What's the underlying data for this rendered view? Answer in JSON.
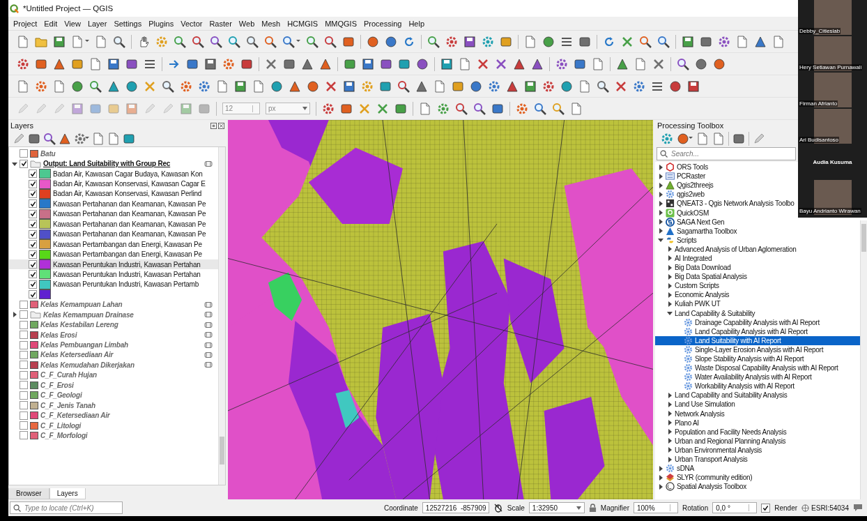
{
  "window": {
    "title": "*Untitled Project — QGIS"
  },
  "menu": [
    "Project",
    "Edit",
    "View",
    "Layer",
    "Settings",
    "Plugins",
    "Vector",
    "Raster",
    "Web",
    "Mesh",
    "HCMGIS",
    "MMQGIS",
    "Processing",
    "Help"
  ],
  "digitizing_toolbar": {
    "size_value": "12",
    "unit": "px"
  },
  "layers_panel": {
    "title": "Layers",
    "items": [
      {
        "kind": "layer",
        "name": "Batu",
        "checked": false,
        "indicator": false,
        "color": "#e0643c"
      },
      {
        "kind": "group",
        "name": "Output: Land Suitability with Group Rec",
        "checked": true,
        "indicator": true,
        "expanded": true,
        "children": [
          {
            "name": "Badan Air, Kawasan Cagar Budaya, Kawasan Kon",
            "checked": true,
            "selected": false,
            "color": "#4cc890"
          },
          {
            "name": "Badan Air, Kawasan Konservasi, Kawasan Cagar E",
            "checked": true,
            "selected": false,
            "color": "#e858c8"
          },
          {
            "name": "Badan Air, Kawasan Konservasi, Kawasan Perlind",
            "checked": true,
            "selected": false,
            "color": "#e04020"
          },
          {
            "name": "Kawasan Pertahanan dan Keamanan, Kawasan Pe",
            "checked": true,
            "selected": false,
            "color": "#2878c8"
          },
          {
            "name": "Kawasan Pertahanan dan Keamanan, Kawasan Pe",
            "checked": true,
            "selected": false,
            "color": "#c87088"
          },
          {
            "name": "Kawasan Pertahanan dan Keamanan, Kawasan Pe",
            "checked": true,
            "selected": false,
            "color": "#b8c458"
          },
          {
            "name": "Kawasan Pertahanan dan Keamanan, Kawasan Pe",
            "checked": true,
            "selected": false,
            "color": "#5050c8"
          },
          {
            "name": "Kawasan Pertambangan dan Energi, Kawasan Pe",
            "checked": true,
            "selected": false,
            "color": "#d8a040"
          },
          {
            "name": "Kawasan Pertambangan dan Energi, Kawasan Pe",
            "checked": true,
            "selected": false,
            "color": "#58d818"
          },
          {
            "name": "Kawasan Peruntukan Industri, Kawasan Pertahan",
            "checked": true,
            "selected": true,
            "color": "#b030d8"
          },
          {
            "name": "Kawasan Peruntukan Industri, Kawasan Pertahan",
            "checked": true,
            "selected": false,
            "color": "#60e078"
          },
          {
            "name": "Kawasan Peruntukan Industri, Kawasan Pertamb",
            "checked": true,
            "selected": false,
            "color": "#40c8c0"
          },
          {
            "checked": true,
            "selected": false,
            "color": "#6020d0"
          }
        ]
      },
      {
        "kind": "layer",
        "name": "Kelas Kemampuan Lahan",
        "checked": false,
        "indicator": true,
        "color": "#e06078"
      },
      {
        "kind": "group",
        "name": "Kelas Kemampuan Drainase",
        "checked": false,
        "indicator": true,
        "expanded": false
      },
      {
        "kind": "layer",
        "name": "Kelas Kestabilan Lereng",
        "checked": false,
        "indicator": true,
        "color": "#70a860"
      },
      {
        "kind": "layer",
        "name": "Kelas Erosi",
        "checked": false,
        "indicator": true,
        "color": "#b84050"
      },
      {
        "kind": "layer",
        "name": "Kelas Pembuangan Limbah",
        "checked": false,
        "indicator": true,
        "color": "#e04878"
      },
      {
        "kind": "layer",
        "name": "Kelas Ketersediaan Air",
        "checked": false,
        "indicator": true,
        "color": "#70a860"
      },
      {
        "kind": "layer",
        "name": "Kelas Kemudahan Dikerjakan",
        "checked": false,
        "indicator": true,
        "color": "#b84050"
      },
      {
        "kind": "layer",
        "name": "C_F_Curah Hujan",
        "checked": false,
        "indicator": false,
        "color": "#e06078"
      },
      {
        "kind": "layer",
        "name": "C_F_Erosi",
        "checked": false,
        "indicator": false,
        "color": "#5c8c60"
      },
      {
        "kind": "layer",
        "name": "C_F_Geologi",
        "checked": false,
        "indicator": false,
        "color": "#70a860"
      },
      {
        "kind": "layer",
        "name": "C_F_Jenis Tanah",
        "checked": false,
        "indicator": false,
        "color": "#c0b090"
      },
      {
        "kind": "layer",
        "name": "C_F_Ketersediaan Air",
        "checked": false,
        "indicator": false,
        "color": "#e04878"
      },
      {
        "kind": "layer",
        "name": "C_F_Litologi",
        "checked": false,
        "indicator": false,
        "color": "#e86840"
      },
      {
        "kind": "layer",
        "name": "C_F_Morfologi",
        "checked": false,
        "indicator": false,
        "color": "#e06078"
      }
    ],
    "tabs": [
      {
        "label": "Browser",
        "selected": false
      },
      {
        "label": "Layers",
        "selected": true
      }
    ]
  },
  "locator": {
    "placeholder": "Type to locate (Ctrl+K)"
  },
  "processing_toolbox": {
    "title": "Processing Toolbox",
    "search": {
      "placeholder": "Search..."
    },
    "providers": [
      {
        "label": "ORS Tools",
        "expanded": false
      },
      {
        "label": "PCRaster",
        "expanded": false
      },
      {
        "label": "Qgis2threejs",
        "expanded": false
      },
      {
        "label": "qgis2web",
        "expanded": false
      },
      {
        "label": "QNEAT3 - Qgis Network Analysis Toolbo",
        "expanded": false
      },
      {
        "label": "QuickOSM",
        "expanded": false
      },
      {
        "label": "SAGA Next Gen",
        "expanded": false
      },
      {
        "label": "Sagamartha Toolbox",
        "expanded": false
      },
      {
        "label": "Scripts",
        "expanded": true,
        "children": [
          {
            "label": "Advanced Analysis of Urban Aglomeration",
            "expanded": false
          },
          {
            "label": "AI Integrated",
            "expanded": false
          },
          {
            "label": "Big Data Download",
            "expanded": false
          },
          {
            "label": "Big Data Spatial Analysis",
            "expanded": false
          },
          {
            "label": "Custom Scripts",
            "expanded": false
          },
          {
            "label": "Economic Analysis",
            "expanded": false
          },
          {
            "label": "Kuliah PWK UT",
            "expanded": false
          },
          {
            "label": "Land Capability & Suitability",
            "expanded": true,
            "children": [
              {
                "label": "Drainage Capability Analysis with AI Report",
                "selected": false
              },
              {
                "label": "Land Capability Analysis with AI Report",
                "selected": false
              },
              {
                "label": "Land Suitability with AI Report",
                "selected": true
              },
              {
                "label": "Single-Layer Erosion Analysis with AI Report",
                "selected": false
              },
              {
                "label": "Slope Stability Analysis with AI Report",
                "selected": false
              },
              {
                "label": "Waste Disposal Capability Analysis with AI Report",
                "selected": false
              },
              {
                "label": "Water Availability Analysis with AI Report",
                "selected": false
              },
              {
                "label": "Workability Analysis with AI Report",
                "selected": false
              }
            ]
          },
          {
            "label": "Land Capability and Suitability Analysis",
            "expanded": false
          },
          {
            "label": "Land Use Simulation",
            "expanded": false
          },
          {
            "label": "Network Analysis",
            "expanded": false
          },
          {
            "label": "Plano AI",
            "expanded": false
          },
          {
            "label": "Population and Facility Needs Analysis",
            "expanded": false
          },
          {
            "label": "Urban and Regional Planning Analysis",
            "expanded": false
          },
          {
            "label": "Urban Environmental Analysis",
            "expanded": false
          },
          {
            "label": "Urban Transport Analysis",
            "expanded": false
          }
        ]
      },
      {
        "label": "sDNA",
        "expanded": false
      },
      {
        "label": "SLYR (community edition)",
        "expanded": false
      },
      {
        "label": "Spatial Analysis Toolbox",
        "expanded": false
      }
    ]
  },
  "status_bar": {
    "coordinate_label": "Coordinate",
    "coordinate": "12527216  -857909",
    "scale_label": "Scale",
    "scale": "1:32950",
    "magnifier_label": "Magnifier",
    "magnifier": "100%",
    "rotation_label": "Rotation",
    "rotation": "0,0 °",
    "render": {
      "label": "Render",
      "checked": true
    },
    "crs": "ESRI:54034"
  },
  "meeting_participants": [
    {
      "name": "Debby_Citieslab",
      "kind": "video"
    },
    {
      "name": "Hery Setiawan Purnawali",
      "kind": "video"
    },
    {
      "name": "Firman Afrianto",
      "kind": "video"
    },
    {
      "name": "Ari Budisantoso",
      "kind": "video"
    },
    {
      "name": "Audia Kusuma",
      "kind": "name-only"
    },
    {
      "name": "Bayu Andrianto Wirawan",
      "kind": "video"
    }
  ]
}
